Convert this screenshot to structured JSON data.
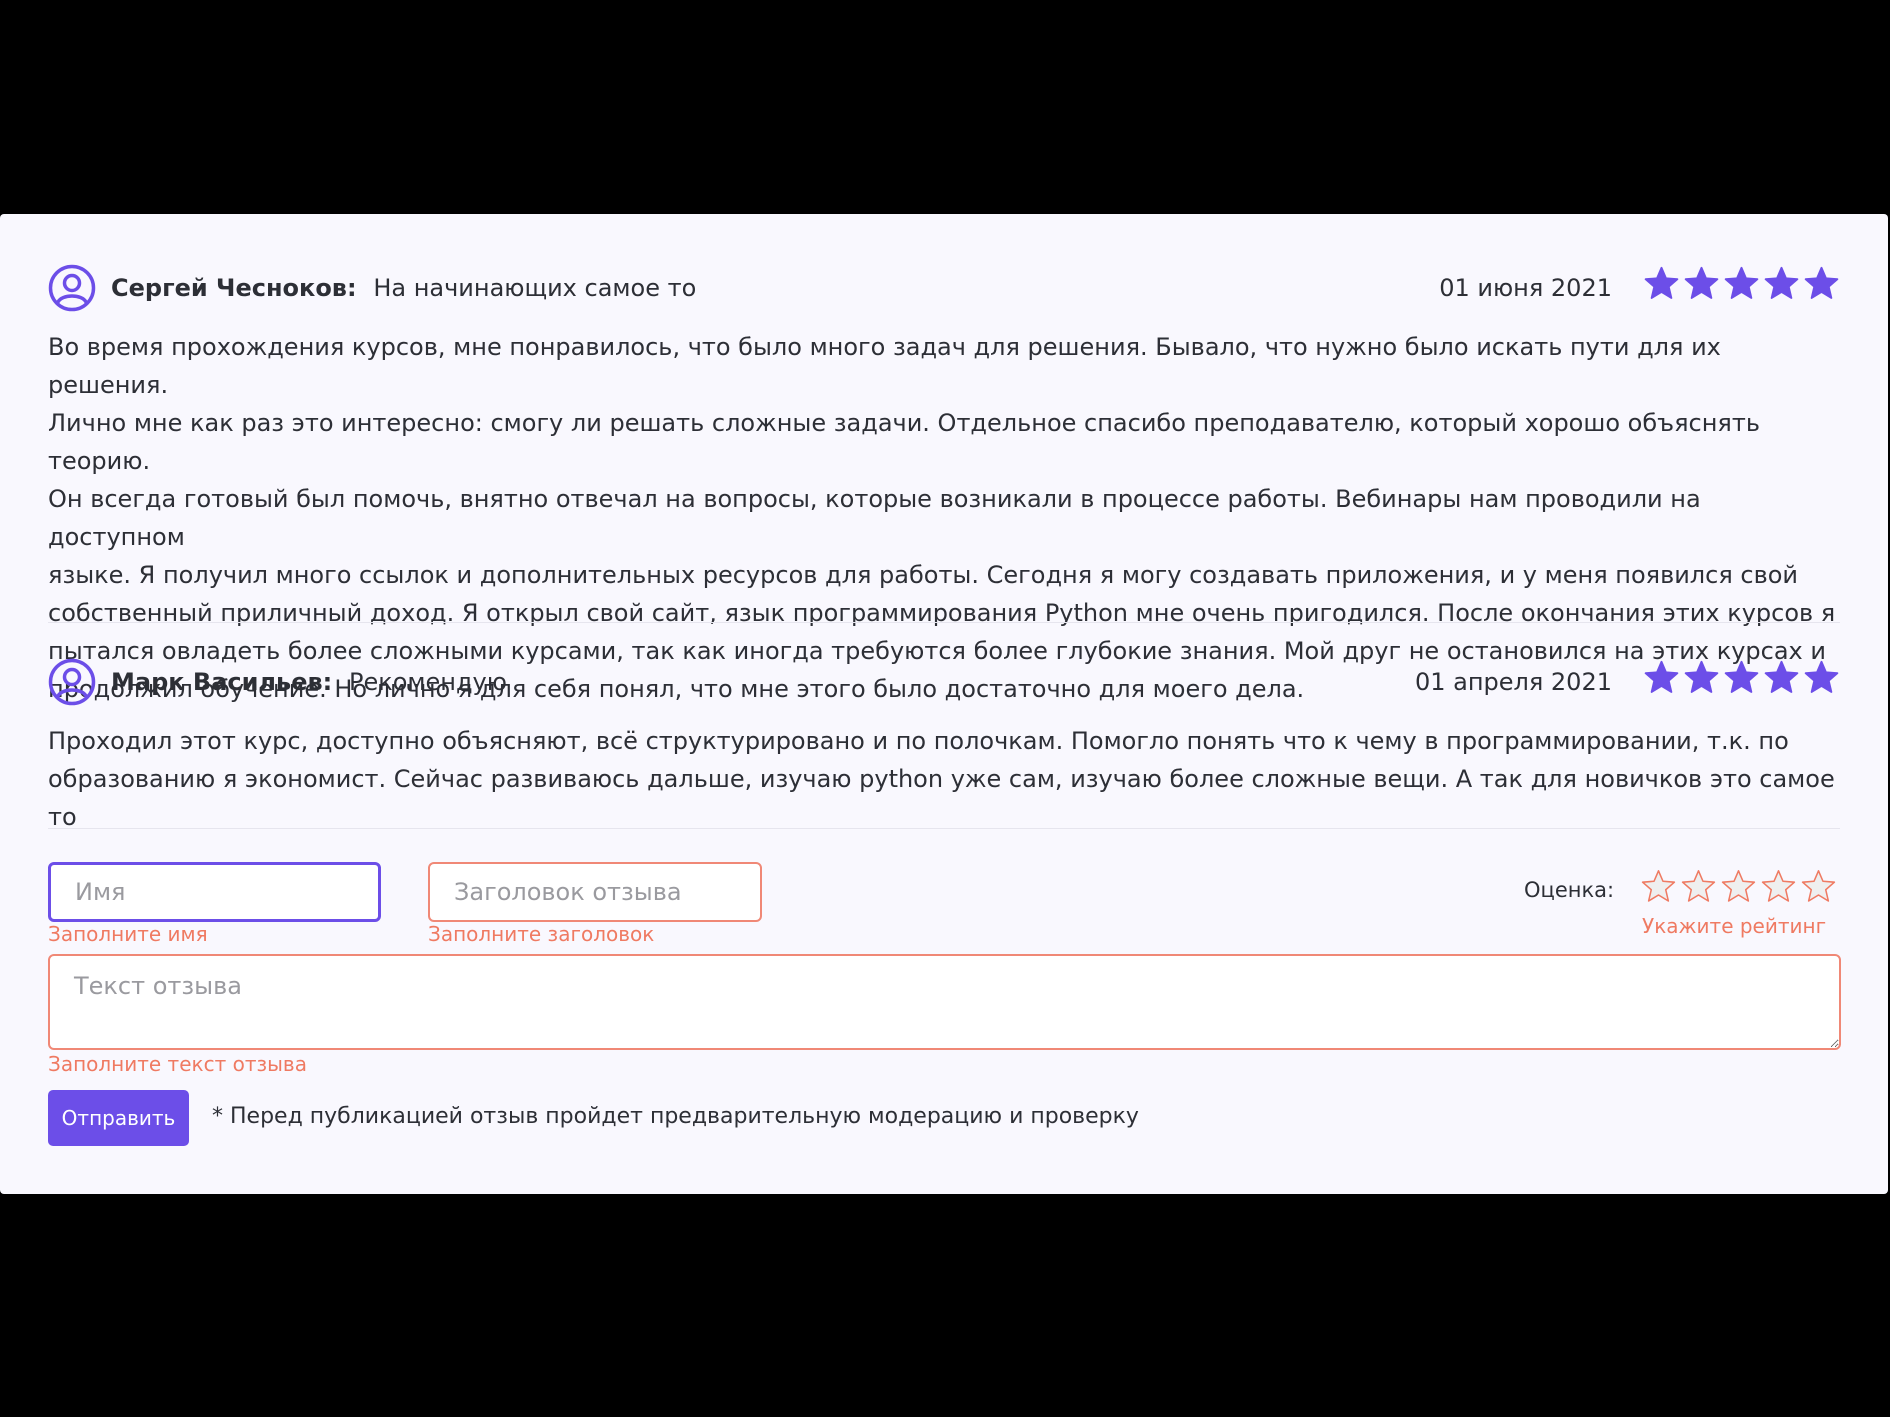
{
  "colors": {
    "accent": "#6c4ee8",
    "error": "#ef7a62",
    "card_bg": "#f9f8fe",
    "star_empty": "#efefef"
  },
  "reviews": [
    {
      "author": "Сергей Чесноков:",
      "title": "На начинающих самое то",
      "date": "01 июня 2021",
      "rating": 5,
      "lines": [
        "Во время прохождения курсов, мне понравилось, что было много задач для решения. Бывало, что нужно было искать пути для их решения.",
        "Лично мне как раз это интересно: смогу ли решать сложные задачи. Отдельное спасибо преподавателю, который хорошо объяснять теорию.",
        "Он всегда готовый был помочь, внятно отвечал на вопросы, которые возникали в процессе работы. Вебинары нам проводили на доступном",
        "языке. Я получил много ссылок и дополнительных ресурсов для работы. Сегодня я могу создавать приложения, и у меня появился свой",
        "собственный приличный доход. Я открыл свой сайт, язык программирования Python мне очень пригодился. После окончания этих курсов я",
        "пытался овладеть более сложными курсами, так как иногда требуются более глубокие знания. Мой друг не остановился на этих курсах и",
        "продолжил обучение. Но лично я для себя понял, что мне этого было достаточно для моего дела."
      ]
    },
    {
      "author": "Марк Васильев:",
      "title": "Рекомендую",
      "date": "01 апреля 2021",
      "rating": 5,
      "lines": [
        "Проходил этот курс, доступно объясняют, всё структурировано и по полочкам. Помогло понять что к чему в программировании, т.к. по",
        "образованию я экономист. Сейчас развиваюсь дальше, изучаю python уже сам, изучаю более сложные вещи. А так для новичков это самое то"
      ]
    }
  ],
  "form": {
    "name_placeholder": "Имя",
    "name_value": "",
    "name_error": "Заполните имя",
    "title_placeholder": "Заголовок отзыва",
    "title_value": "",
    "title_error": "Заполните заголовок",
    "rating_label": "Оценка:",
    "rating_value": 0,
    "rating_max": 5,
    "rating_error": "Укажите рейтинг",
    "text_placeholder": "Текст отзыва",
    "text_value": "",
    "text_error": "Заполните текст отзыва",
    "submit_label": "Отправить",
    "note": "* Перед публикацией отзыв пройдет предварительную модерацию и проверку"
  },
  "icons": {
    "avatar": "user-circle-icon",
    "star": "star-icon"
  }
}
